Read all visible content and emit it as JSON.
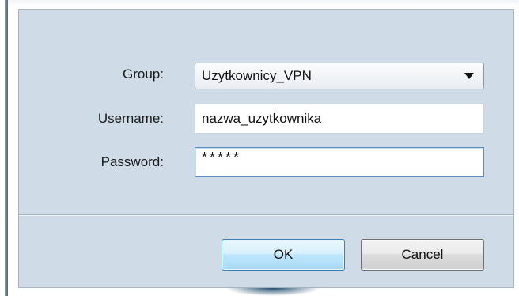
{
  "form": {
    "group_label": "Group:",
    "group_value": "Uzytkownicy_VPN",
    "username_label": "Username:",
    "username_value": "nazwa_uzytkownika",
    "password_label": "Password:",
    "password_value": "*****"
  },
  "buttons": {
    "ok_label": "OK",
    "cancel_label": "Cancel"
  },
  "icons": {
    "dropdown": "chevron-down-icon"
  },
  "colors": {
    "dialog_bg": "#cfdbe6",
    "ok_border": "#3c7fb1",
    "focus_border": "#5a8cc7"
  }
}
